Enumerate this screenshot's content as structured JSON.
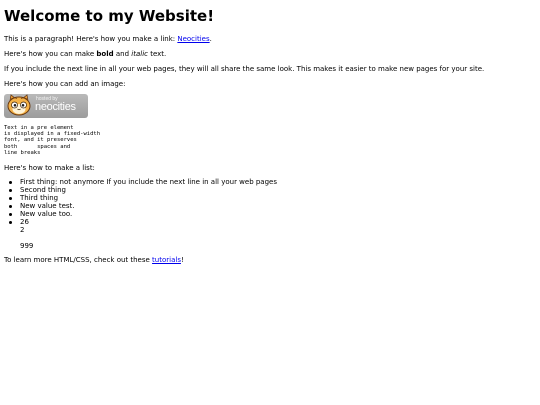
{
  "heading": "Welcome to my Website!",
  "para1": {
    "text": "This is a paragraph! Here's how you make a link: ",
    "link": "Neocities",
    "end": "."
  },
  "para2": {
    "before": "Here's how you can make ",
    "bold": "bold",
    "middle": " and ",
    "italic": "italic",
    "after": " text."
  },
  "para3": "If you include the next line in all your web pages, they will all share the same look. This makes it easier to make new pages for your site.",
  "para4": "Here's how you can add an image:",
  "badge": {
    "small": "hosted by",
    "big": "neocities",
    "icon": "neocities-cat-icon"
  },
  "pre_text": "Text in a pre element\nis displayed in a fixed-width\nfont, and it preserves\nboth      spaces and\nline breaks",
  "list_intro": "Here's how to make a list:",
  "list": [
    "First thing: not anymore If you include the next line in all your web pages",
    "Second thing",
    "Third thing",
    "New value test.",
    "New value too.",
    "26",
    "2",
    "",
    "999"
  ],
  "footer": {
    "text": "To learn more HTML/CSS, check out these ",
    "link": "tutorials",
    "end": "!"
  }
}
